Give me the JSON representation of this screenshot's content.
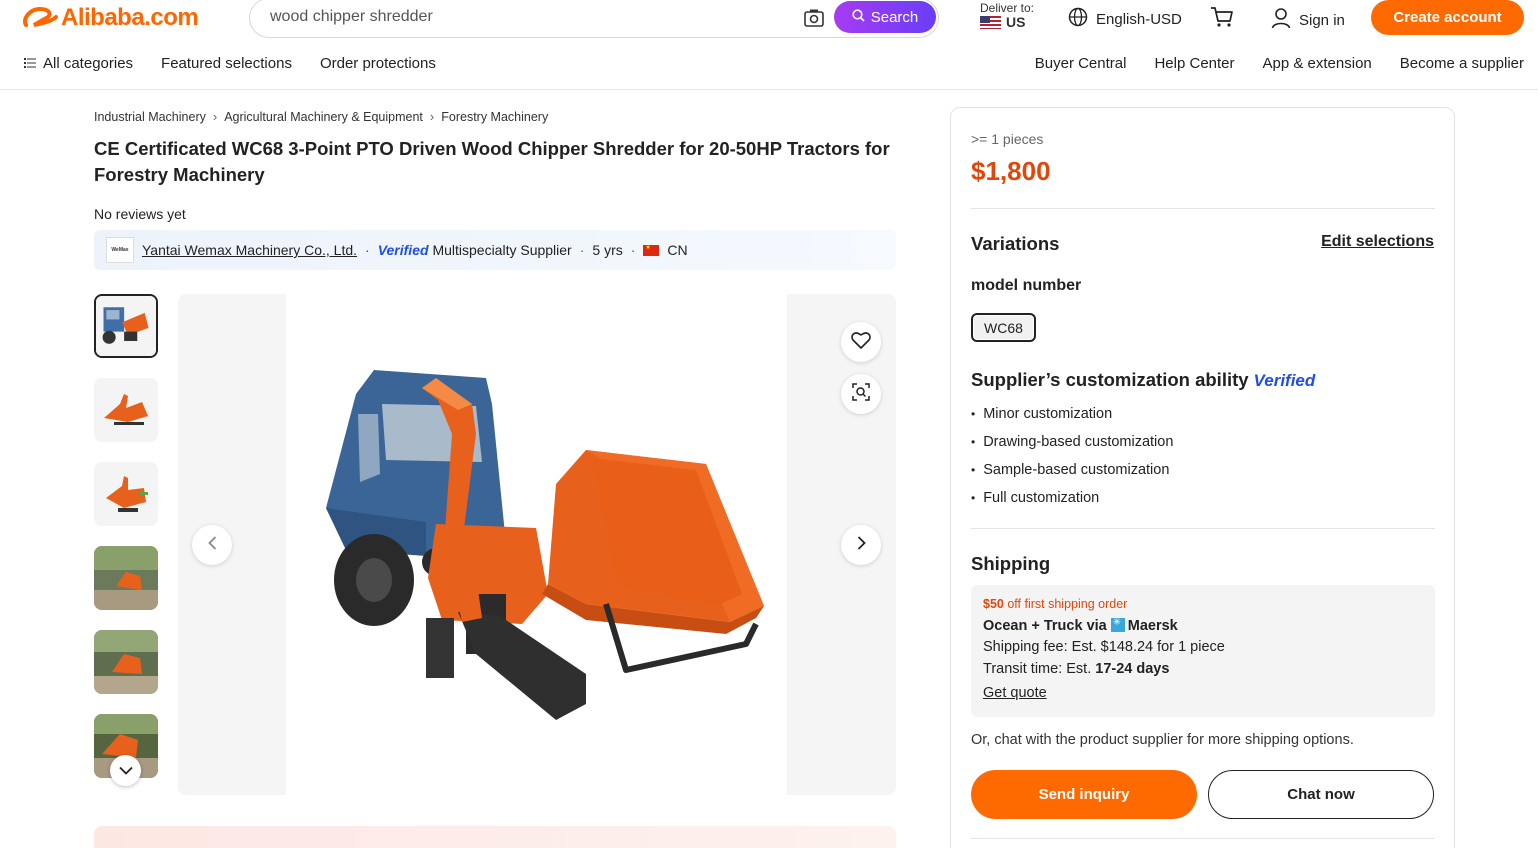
{
  "header": {
    "logo_text": "Alibaba.com",
    "search": {
      "value": "wood chipper shredder",
      "button_label": "Search"
    },
    "deliver_to": {
      "label": "Deliver to:",
      "country": "US"
    },
    "language": "English-USD",
    "sign_in": "Sign in",
    "create_account": "Create account",
    "nav_left": [
      "All categories",
      "Featured selections",
      "Order protections"
    ],
    "nav_right": [
      "Buyer Central",
      "Help Center",
      "App & extension",
      "Become a supplier"
    ],
    "brand_color": "#ff6a00"
  },
  "product": {
    "breadcrumbs": [
      "Industrial Machinery",
      "Agricultural Machinery & Equipment",
      "Forestry Machinery"
    ],
    "title": "CE Certificated WC68 3-Point PTO Driven Wood Chipper Shredder for 20-50HP Tractors for Forestry Machinery",
    "reviews": "No reviews yet",
    "supplier": {
      "logo_text": "WeMax",
      "name": "Yantai Wemax Machinery Co., Ltd.",
      "verified": "Verified",
      "type": "Multispecialty Supplier",
      "years": "5 yrs",
      "country": "CN"
    }
  },
  "panel": {
    "quantity": ">= 1 pieces",
    "price": "$1,800",
    "price_color": "#e2470a",
    "variations_title": "Variations",
    "edit_selections": "Edit selections",
    "model_label": "model number",
    "model_value": "WC68",
    "customization_title": "Supplier’s customization ability",
    "customization_verified": "Verified",
    "customization_items": [
      "Minor customization",
      "Drawing-based customization",
      "Sample-based customization",
      "Full customization"
    ],
    "shipping_title": "Shipping",
    "shipping": {
      "promo_amount": "$50",
      "promo_text": "off first shipping order",
      "method": "Ocean + Truck via",
      "carrier": "Maersk",
      "fee": "Shipping fee: Est. $148.24 for 1 piece",
      "transit_label": "Transit time: Est.",
      "transit_value": "17-24 days",
      "quote": "Get quote"
    },
    "chat_note": "Or, chat with the product supplier for more shipping options.",
    "send_inquiry": "Send inquiry",
    "chat_now": "Chat now"
  }
}
